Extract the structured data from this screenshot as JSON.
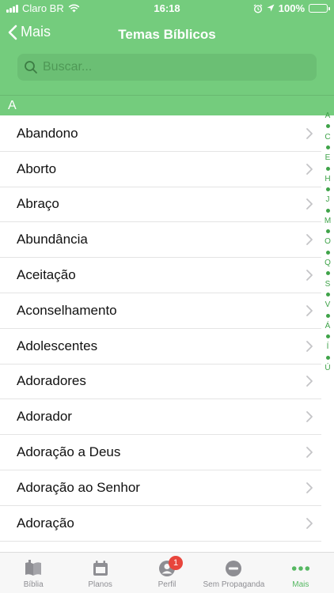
{
  "status_bar": {
    "carrier": "Claro BR",
    "time": "16:18",
    "battery": "100%"
  },
  "nav": {
    "back_label": "Mais",
    "title": "Temas Bíblicos"
  },
  "search": {
    "placeholder": "Buscar...",
    "value": ""
  },
  "section": {
    "header": "A"
  },
  "list": {
    "items": [
      "Abandono",
      "Aborto",
      "Abraço",
      "Abundância",
      "Aceitação",
      "Aconselhamento",
      "Adolescentes",
      "Adoradores",
      "Adorador",
      "Adoração a Deus",
      "Adoração ao Senhor",
      "Adoração"
    ]
  },
  "index": {
    "letters": [
      "A",
      "C",
      "E",
      "H",
      "J",
      "M",
      "O",
      "Q",
      "S",
      "V",
      "Á",
      "Í",
      "Ú"
    ]
  },
  "tabs": [
    {
      "label": "Bíblia",
      "icon": "bible-icon"
    },
    {
      "label": "Planos",
      "icon": "calendar-icon"
    },
    {
      "label": "Perfil",
      "icon": "profile-icon",
      "badge": "1"
    },
    {
      "label": "Sem Propaganda",
      "icon": "no-ads-icon"
    },
    {
      "label": "Mais",
      "icon": "more-icon",
      "active": true
    }
  ],
  "colors": {
    "brand_green": "#74cc7d",
    "accent_green": "#3fa349",
    "badge_red": "#e8453c"
  }
}
